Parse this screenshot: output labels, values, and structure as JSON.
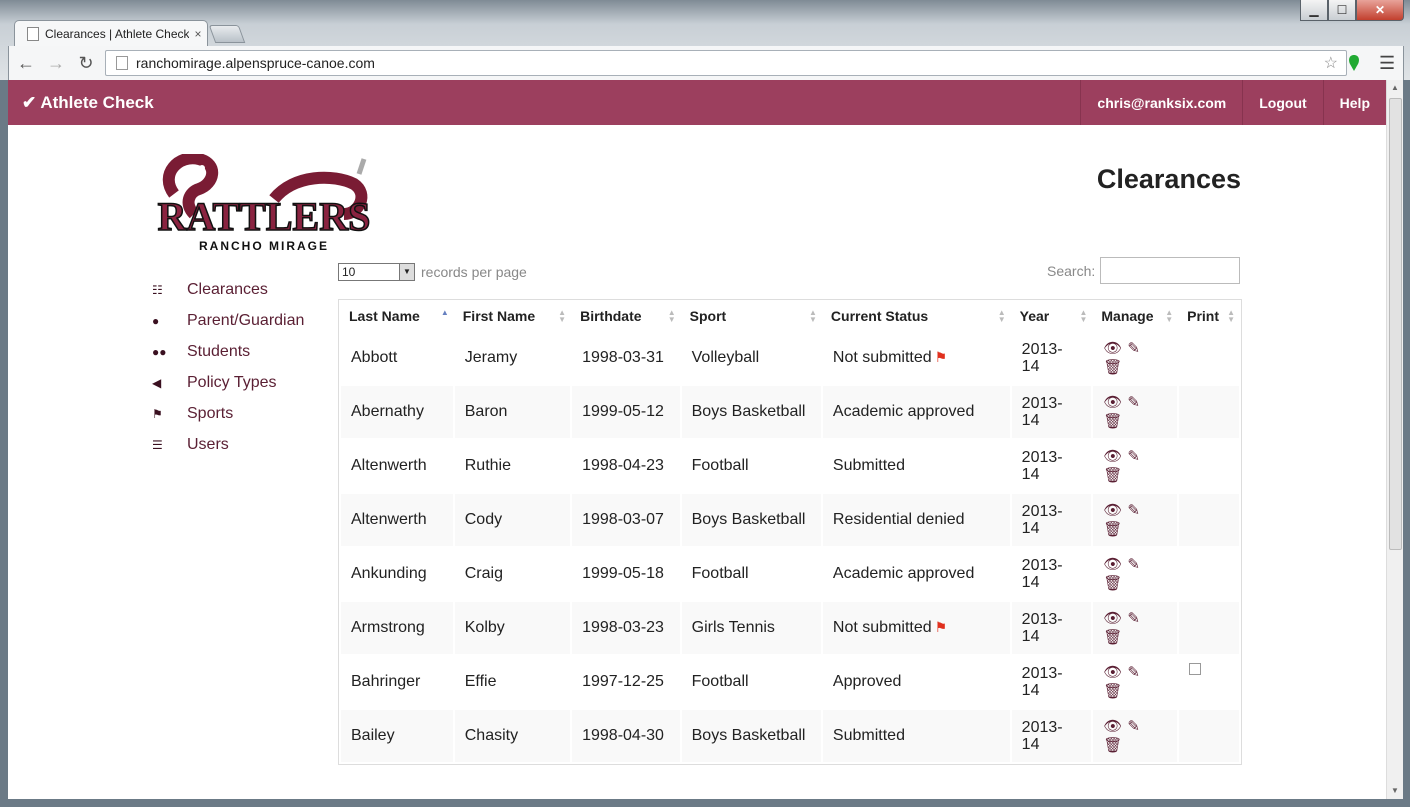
{
  "browser": {
    "tab_title": "Clearances | Athlete Check",
    "url": "ranchomirage.alpenspruce-canoe.com"
  },
  "navbar": {
    "brand": "✔ Athlete Check",
    "user": "chris@ranksix.com",
    "logout": "Logout",
    "help": "Help"
  },
  "logo": {
    "top_text": "RATTLERS",
    "bottom_text": "RANCHO MIRAGE"
  },
  "page_title": "Clearances",
  "sidebar": {
    "items": [
      {
        "label": "Clearances",
        "icon": "list-icon"
      },
      {
        "label": "Parent/Guardian",
        "icon": "user-icon"
      },
      {
        "label": "Students",
        "icon": "group-icon"
      },
      {
        "label": "Policy Types",
        "icon": "bullhorn-icon"
      },
      {
        "label": "Sports",
        "icon": "flag-icon"
      },
      {
        "label": "Users",
        "icon": "user-list-icon"
      }
    ]
  },
  "table_controls": {
    "length_value": "10",
    "length_label": "records per page",
    "search_label": "Search:",
    "search_value": ""
  },
  "table": {
    "headers": [
      "Last Name",
      "First Name",
      "Birthdate",
      "Sport",
      "Current Status",
      "Year",
      "Manage",
      "Print"
    ],
    "rows": [
      {
        "last": "Abbott",
        "first": "Jeramy",
        "birthdate": "1998-03-31",
        "sport": "Volleyball",
        "status": "Not submitted",
        "flag": true,
        "year_a": "2013-",
        "year_b": "14",
        "print": false
      },
      {
        "last": "Abernathy",
        "first": "Baron",
        "birthdate": "1999-05-12",
        "sport": "Boys Basketball",
        "status": "Academic approved",
        "flag": false,
        "year_a": "2013-",
        "year_b": "14",
        "print": false
      },
      {
        "last": "Altenwerth",
        "first": "Ruthie",
        "birthdate": "1998-04-23",
        "sport": "Football",
        "status": "Submitted",
        "flag": false,
        "year_a": "2013-",
        "year_b": "14",
        "print": false
      },
      {
        "last": "Altenwerth",
        "first": "Cody",
        "birthdate": "1998-03-07",
        "sport": "Boys Basketball",
        "status": "Residential denied",
        "flag": false,
        "year_a": "2013-",
        "year_b": "14",
        "print": false
      },
      {
        "last": "Ankunding",
        "first": "Craig",
        "birthdate": "1999-05-18",
        "sport": "Football",
        "status": "Academic approved",
        "flag": false,
        "year_a": "2013-",
        "year_b": "14",
        "print": false
      },
      {
        "last": "Armstrong",
        "first": "Kolby",
        "birthdate": "1998-03-23",
        "sport": "Girls Tennis",
        "status": "Not submitted",
        "flag": true,
        "year_a": "2013-",
        "year_b": "14",
        "print": false
      },
      {
        "last": "Bahringer",
        "first": "Effie",
        "birthdate": "1997-12-25",
        "sport": "Football",
        "status": "Approved",
        "flag": false,
        "year_a": "2013-",
        "year_b": "14",
        "print": true
      },
      {
        "last": "Bailey",
        "first": "Chasity",
        "birthdate": "1998-04-30",
        "sport": "Boys Basketball",
        "status": "Submitted",
        "flag": false,
        "year_a": "2013-",
        "year_b": "14",
        "print": false
      }
    ]
  },
  "colors": {
    "brand": "#9c3f5e",
    "link": "#5a1f33",
    "flag": "#e0301e"
  }
}
